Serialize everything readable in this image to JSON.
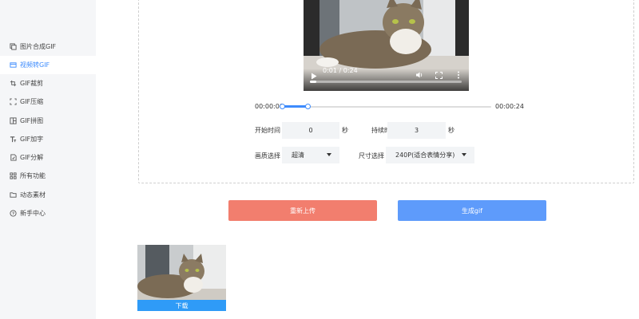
{
  "sidebar": {
    "items": [
      {
        "label": "图片合成GIF",
        "icon": "copy-icon",
        "active": false
      },
      {
        "label": "视频转GIF",
        "icon": "video-icon",
        "active": true
      },
      {
        "label": "GIF裁剪",
        "icon": "crop-icon",
        "active": false
      },
      {
        "label": "GIF压缩",
        "icon": "compress-icon",
        "active": false
      },
      {
        "label": "GIF拼图",
        "icon": "grid-icon",
        "active": false
      },
      {
        "label": "GIF加字",
        "icon": "text-icon",
        "active": false
      },
      {
        "label": "GIF分解",
        "icon": "split-icon",
        "active": false
      },
      {
        "label": "所有功能",
        "icon": "apps-icon",
        "active": false
      },
      {
        "label": "动态素材",
        "icon": "folder-icon",
        "active": false
      },
      {
        "label": "新手中心",
        "icon": "help-icon",
        "active": false
      }
    ]
  },
  "video": {
    "time": "0:01 / 0:24",
    "progress": 0.04
  },
  "timeline": {
    "start_label": "00:00:00",
    "end_label": "00:00:24",
    "range_start": 0,
    "range_end": 3,
    "duration": 24
  },
  "form": {
    "start_time_label": "开始时间",
    "start_time_value": "0",
    "start_unit": "秒",
    "duration_label": "持续时间",
    "duration_value": "3",
    "duration_unit": "秒",
    "quality_label": "画质选择",
    "quality_value": "超清",
    "size_label": "尺寸选择",
    "size_value": "240P(适合表情分享)"
  },
  "actions": {
    "reupload_label": "重新上传",
    "generate_label": "生成gif"
  },
  "result": {
    "download_label": "下载"
  },
  "colors": {
    "accent": "#3d8bfd",
    "reupload": "#f27e6e",
    "generate": "#5e9bfb",
    "download": "#2f9bf7"
  }
}
